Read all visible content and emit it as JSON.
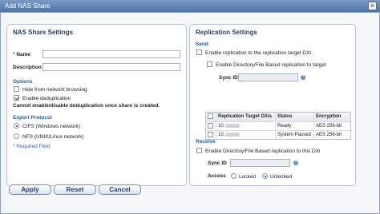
{
  "window": {
    "title": "Add NAS Share",
    "close_glyph": "×"
  },
  "left": {
    "title": "NAS Share Settings",
    "name_label": "Name",
    "description_label": "Description",
    "required_marker": "*",
    "options_title": "Options",
    "hide_browsing": "Hide from network browsing",
    "enable_dedup": "Enable deduplication",
    "dedup_note": "Cannot enable/disable deduplication once share is created.",
    "export_title": "Export Protocol",
    "cifs": "CIFS (Windows network)",
    "nfs": "NFS (UNIX/Linux network)",
    "required_note": "* Required Field"
  },
  "right": {
    "title": "Replication Settings",
    "send_title": "Send",
    "enable_replication": "Enable replication to the replication target DXi",
    "enable_dir_file": "Enable Directory/File Based replication to target",
    "sync_id_label": "Sync ID",
    "help_glyph": "?",
    "table": {
      "headers": [
        "Replication Target DXis",
        "Status",
        "Encryption"
      ],
      "rows": [
        {
          "target": "10.",
          "status": "Ready",
          "encryption": "AES 256-bit"
        },
        {
          "target": "10.",
          "status": "System Paused",
          "encryption": "AES 256-bit"
        }
      ]
    },
    "receive_title": "Receive",
    "enable_receive": "Enable Directory/File Based replication to this DXi",
    "receive_sync_id_label": "Sync ID",
    "access_label": "Access",
    "locked": "Locked",
    "unlocked": "Unlocked"
  },
  "buttons": {
    "apply": "Apply",
    "reset": "Reset",
    "cancel": "Cancel"
  }
}
